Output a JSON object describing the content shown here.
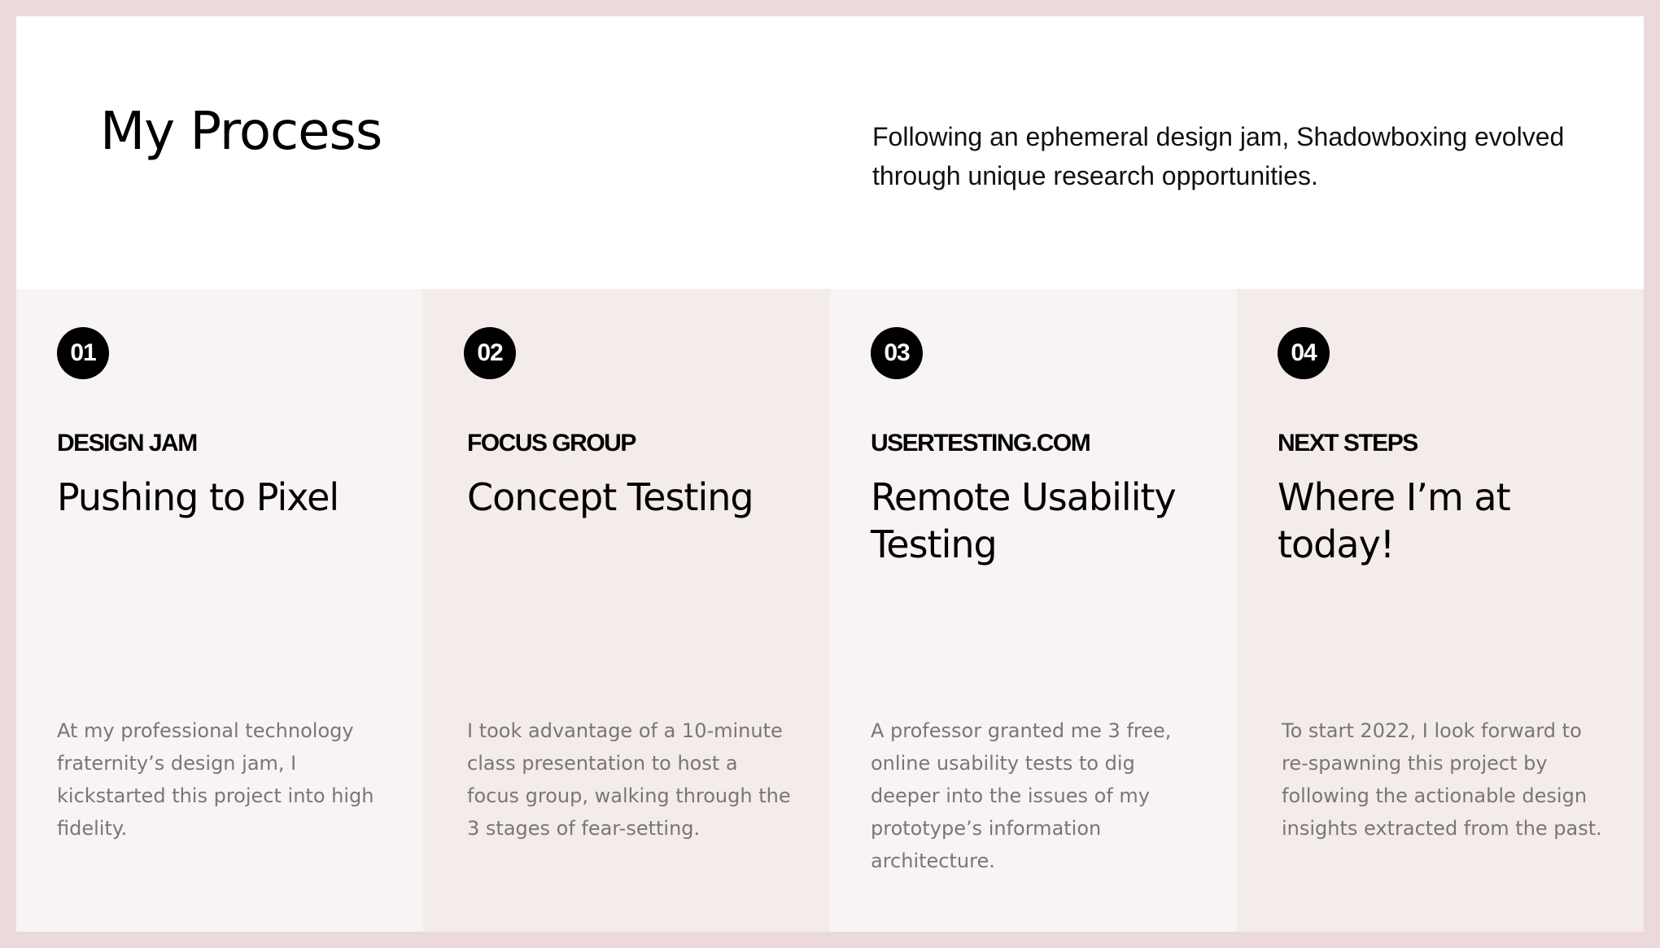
{
  "header": {
    "title": "My Process",
    "intro": "Following an ephemeral design jam, Shadowboxing evolved through unique research opportunities."
  },
  "steps": [
    {
      "number": "01",
      "eyebrow": "DESIGN JAM",
      "title": "Pushing to Pixel",
      "body": "At my professional technology fraternity’s design jam, I kickstarted this project into high fidelity."
    },
    {
      "number": "02",
      "eyebrow": "FOCUS GROUP",
      "title": "Concept Testing",
      "body": "I took advantage of a 10-minute class presentation to host a focus group, walking through the 3 stages of fear-setting."
    },
    {
      "number": "03",
      "eyebrow": "USERTESTING.COM",
      "title": "Remote Usability Testing",
      "body": "A professor granted me 3 free, online usability tests to dig deeper into the issues of my prototype’s information architecture."
    },
    {
      "number": "04",
      "eyebrow": "NEXT STEPS",
      "title": "Where I’m at today!",
      "body": "To start 2022, I look forward to re-spawning this project by following the actionable design insights extracted from the past."
    }
  ],
  "colors": {
    "outer_border": "#ecd9db",
    "card_light": "#f8f4f3",
    "card_dark": "#f4ecea",
    "badge": "#000000",
    "body_text": "#777777"
  }
}
